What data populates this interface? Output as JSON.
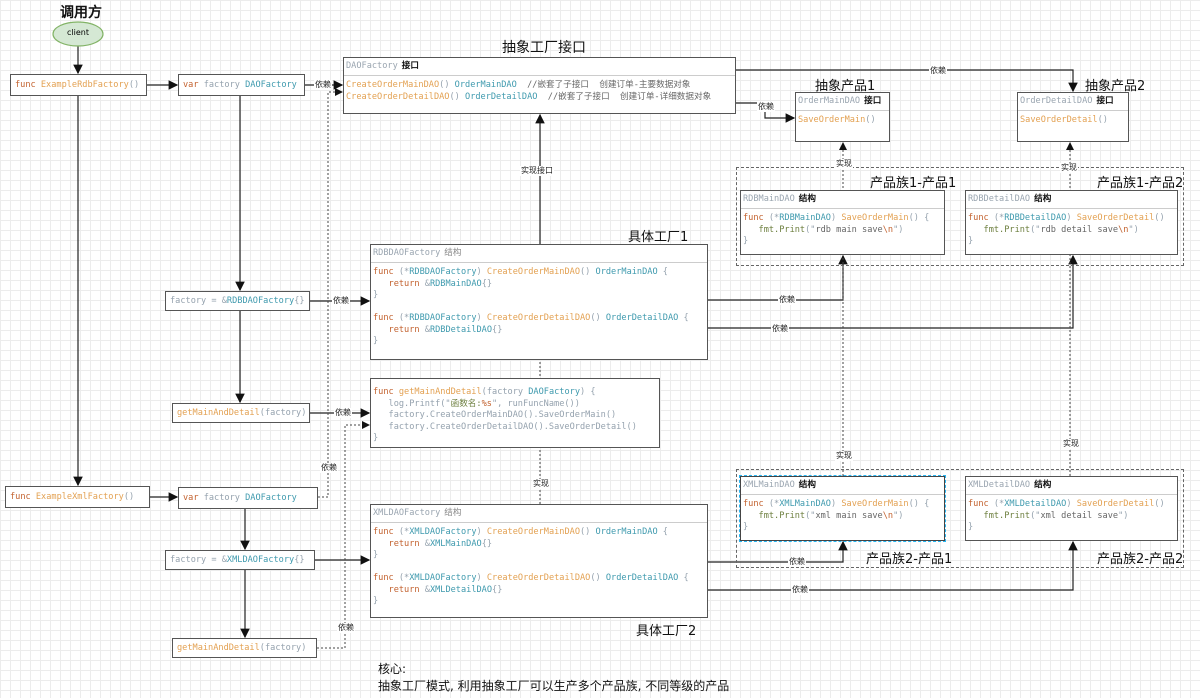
{
  "caller": {
    "title": "调用方",
    "client": "client"
  },
  "titles": {
    "abstract_factory": "抽象工厂接口",
    "abstract_product1": "抽象产品1",
    "abstract_product2": "抽象产品2",
    "family1_product1": "产品族1-产品1",
    "family1_product2": "产品族1-产品2",
    "family2_product1": "产品族2-产品1",
    "family2_product2": "产品族2-产品2",
    "concrete_factory1": "具体工厂1",
    "concrete_factory2": "具体工厂2"
  },
  "edge_labels": {
    "depends": "依赖",
    "implements": "实现",
    "implements_interface": "实现接口"
  },
  "footer": {
    "line1": "核心:",
    "line2": "抽象工厂模式, 利用抽象工厂可以生产多个产品族, 不同等级的产品"
  },
  "colors": {
    "client_fill": "#d5e8d4",
    "client_stroke": "#82b366"
  },
  "boxes": {
    "example_rdb": [
      [
        [
          "k",
          "func "
        ],
        [
          "f",
          "ExampleRdbFactory"
        ],
        [
          "g",
          "()"
        ]
      ]
    ],
    "var_factory1": [
      [
        [
          "k",
          "var "
        ],
        [
          "g",
          "factory "
        ],
        [
          "t",
          "DAOFactory"
        ]
      ]
    ],
    "factory_rdb": [
      [
        [
          "g",
          "factory = &"
        ],
        [
          "t",
          "RDBDAOFactory"
        ],
        [
          "g",
          "{}"
        ]
      ]
    ],
    "get_main1": [
      [
        [
          "f",
          "getMainAndDetail"
        ],
        [
          "g",
          "(factory)"
        ]
      ]
    ],
    "example_xml": [
      [
        [
          "k",
          "func "
        ],
        [
          "f",
          "ExampleXmlFactory"
        ],
        [
          "g",
          "()"
        ]
      ]
    ],
    "var_factory2": [
      [
        [
          "k",
          "var "
        ],
        [
          "g",
          "factory "
        ],
        [
          "t",
          "DAOFactory"
        ]
      ]
    ],
    "factory_xml": [
      [
        [
          "g",
          "factory = &"
        ],
        [
          "t",
          "XMLDAOFactory"
        ],
        [
          "g",
          "{}"
        ]
      ]
    ],
    "get_main2": [
      [
        [
          "f",
          "getMainAndDetail"
        ],
        [
          "g",
          "(factory)"
        ]
      ]
    ]
  },
  "classes": {
    "dao_factory": {
      "name": "DAOFactory",
      "tag": "接口",
      "code": [
        [
          [
            "f",
            "CreateOrderMainDAO"
          ],
          [
            "g",
            "() "
          ],
          [
            "t",
            "OrderMainDAO"
          ],
          [
            "d",
            "  //嵌套了子接口  创建订单-主要数据对象"
          ]
        ],
        [
          [
            "f",
            "CreateOrderDetailDAO"
          ],
          [
            "g",
            "() "
          ],
          [
            "t",
            "OrderDetailDAO"
          ],
          [
            "d",
            "  //嵌套了子接口  创建订单-详细数据对象"
          ]
        ]
      ]
    },
    "order_main": {
      "name": "OrderMainDAO",
      "tag": "接口",
      "code": [
        [
          [
            "f",
            "SaveOrderMain"
          ],
          [
            "g",
            "()"
          ]
        ]
      ]
    },
    "order_detail": {
      "name": "OrderDetailDAO",
      "tag": "接口",
      "code": [
        [
          [
            "f",
            "SaveOrderDetail"
          ],
          [
            "g",
            "()"
          ]
        ]
      ]
    },
    "rdb_main": {
      "name": "RDBMainDAO",
      "tag": "结构",
      "code": [
        [
          [
            "k",
            "func "
          ],
          [
            "g",
            "(*"
          ],
          [
            "t",
            "RDBMainDAO"
          ],
          [
            "g",
            ") "
          ],
          [
            "f",
            "SaveOrderMain"
          ],
          [
            "g",
            "() {"
          ]
        ],
        [
          [
            "s",
            "   fmt.Print"
          ],
          [
            "g",
            "(\""
          ],
          [
            "d",
            "rdb main save"
          ],
          [
            "e",
            "\\n"
          ],
          [
            "g",
            "\")"
          ]
        ],
        [
          [
            "g",
            "}"
          ]
        ]
      ]
    },
    "rdb_detail": {
      "name": "RDBDetailDAO",
      "tag": "结构",
      "code": [
        [
          [
            "k",
            "func "
          ],
          [
            "g",
            "(*"
          ],
          [
            "t",
            "RDBDetailDAO"
          ],
          [
            "g",
            ") "
          ],
          [
            "f",
            "SaveOrderDetail"
          ],
          [
            "g",
            "()"
          ]
        ],
        [
          [
            "s",
            "   fmt.Print"
          ],
          [
            "g",
            "(\""
          ],
          [
            "d",
            "rdb detail save"
          ],
          [
            "e",
            "\\n"
          ],
          [
            "g",
            "\")"
          ]
        ],
        [
          [
            "g",
            "}"
          ]
        ]
      ]
    },
    "rdb_factory": {
      "name": "RDBDAOFactory",
      "tag": "结构",
      "code": [
        [
          [
            "k",
            "func "
          ],
          [
            "g",
            "(*"
          ],
          [
            "t",
            "RDBDAOFactory"
          ],
          [
            "g",
            ") "
          ],
          [
            "f",
            "CreateOrderMainDAO"
          ],
          [
            "g",
            "() "
          ],
          [
            "t",
            "OrderMainDAO"
          ],
          [
            "g",
            " {"
          ]
        ],
        [
          [
            "k",
            "   return "
          ],
          [
            "g",
            "&"
          ],
          [
            "t",
            "RDBMainDAO"
          ],
          [
            "g",
            "{}"
          ]
        ],
        [
          [
            "g",
            "}"
          ]
        ],
        [
          [
            "g",
            " "
          ]
        ],
        [
          [
            "k",
            "func "
          ],
          [
            "g",
            "(*"
          ],
          [
            "t",
            "RDBDAOFactory"
          ],
          [
            "g",
            ") "
          ],
          [
            "f",
            "CreateOrderDetailDAO"
          ],
          [
            "g",
            "() "
          ],
          [
            "t",
            "OrderDetailDAO"
          ],
          [
            "g",
            " {"
          ]
        ],
        [
          [
            "k",
            "   return "
          ],
          [
            "g",
            "&"
          ],
          [
            "t",
            "RDBDetailDAO"
          ],
          [
            "g",
            "{}"
          ]
        ],
        [
          [
            "g",
            "}"
          ]
        ]
      ]
    },
    "get_main_func": {
      "code": [
        [
          [
            "k",
            "func "
          ],
          [
            "f",
            "getMainAndDetail"
          ],
          [
            "g",
            "(factory "
          ],
          [
            "t",
            "DAOFactory"
          ],
          [
            "g",
            ") {"
          ]
        ],
        [
          [
            "g",
            "   log.Printf(\""
          ],
          [
            "s",
            "函数名:"
          ],
          [
            "e",
            "%s"
          ],
          [
            "g",
            "\", runFuncName())"
          ]
        ],
        [
          [
            "g",
            "   factory.CreateOrderMainDAO().SaveOrderMain()"
          ]
        ],
        [
          [
            "g",
            "   factory.CreateOrderDetailDAO().SaveOrderDetail()"
          ]
        ],
        [
          [
            "g",
            "}"
          ]
        ]
      ]
    },
    "xml_main": {
      "name": "XMLMainDAO",
      "tag": "结构",
      "code": [
        [
          [
            "k",
            "func "
          ],
          [
            "g",
            "(*"
          ],
          [
            "t",
            "XMLMainDAO"
          ],
          [
            "g",
            ") "
          ],
          [
            "f",
            "SaveOrderMain"
          ],
          [
            "g",
            "() {"
          ]
        ],
        [
          [
            "s",
            "   fmt.Print"
          ],
          [
            "g",
            "(\""
          ],
          [
            "d",
            "xml main save"
          ],
          [
            "e",
            "\\n"
          ],
          [
            "g",
            "\")"
          ]
        ],
        [
          [
            "g",
            "}"
          ]
        ]
      ]
    },
    "xml_detail": {
      "name": "XMLDetailDAO",
      "tag": "结构",
      "code": [
        [
          [
            "k",
            "func "
          ],
          [
            "g",
            "(*"
          ],
          [
            "t",
            "XMLDetailDAO"
          ],
          [
            "g",
            ") "
          ],
          [
            "f",
            "SaveOrderDetail"
          ],
          [
            "g",
            "()"
          ]
        ],
        [
          [
            "s",
            "   fmt.Print"
          ],
          [
            "g",
            "(\""
          ],
          [
            "d",
            "xml detail save"
          ],
          [
            "g",
            "\")"
          ]
        ],
        [
          [
            "g",
            "}"
          ]
        ]
      ]
    },
    "xml_factory": {
      "name": "XMLDAOFactory",
      "tag": "结构",
      "code": [
        [
          [
            "k",
            "func "
          ],
          [
            "g",
            "(*"
          ],
          [
            "t",
            "XMLDAOFactory"
          ],
          [
            "g",
            ") "
          ],
          [
            "f",
            "CreateOrderMainDAO"
          ],
          [
            "g",
            "() "
          ],
          [
            "t",
            "OrderMainDAO"
          ],
          [
            "g",
            " {"
          ]
        ],
        [
          [
            "k",
            "   return "
          ],
          [
            "g",
            "&"
          ],
          [
            "t",
            "XMLMainDAO"
          ],
          [
            "g",
            "{}"
          ]
        ],
        [
          [
            "g",
            "}"
          ]
        ],
        [
          [
            "g",
            " "
          ]
        ],
        [
          [
            "k",
            "func "
          ],
          [
            "g",
            "(*"
          ],
          [
            "t",
            "XMLDAOFactory"
          ],
          [
            "g",
            ") "
          ],
          [
            "f",
            "CreateOrderDetailDAO"
          ],
          [
            "g",
            "() "
          ],
          [
            "t",
            "OrderDetailDAO"
          ],
          [
            "g",
            " {"
          ]
        ],
        [
          [
            "k",
            "   return "
          ],
          [
            "g",
            "&"
          ],
          [
            "t",
            "XMLDetailDAO"
          ],
          [
            "g",
            "{}"
          ]
        ],
        [
          [
            "g",
            "}"
          ]
        ]
      ]
    }
  }
}
